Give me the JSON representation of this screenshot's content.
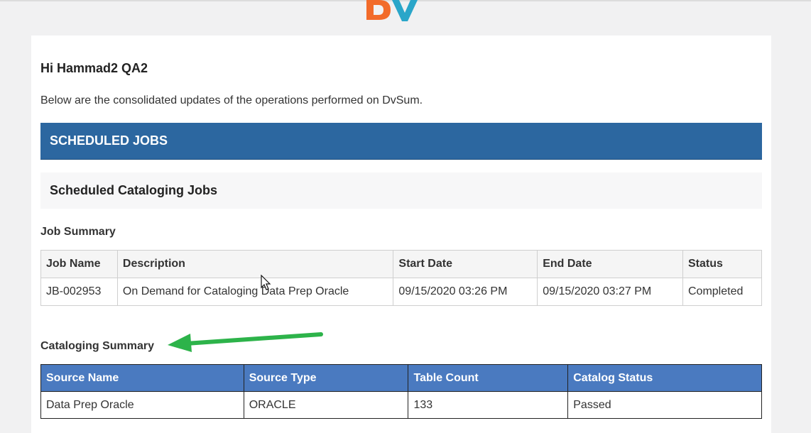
{
  "logo": {
    "text": "DV",
    "colors": {
      "d": "#f26b2a",
      "v": "#2aa6c9"
    }
  },
  "email": {
    "greeting": "Hi Hammad2 QA2",
    "intro": "Below are the consolidated updates of the operations performed on DvSum.",
    "banner": "SCHEDULED JOBS",
    "subheading": "Scheduled Cataloging Jobs"
  },
  "job_summary": {
    "label": "Job Summary",
    "headers": [
      "Job Name",
      "Description",
      "Start Date",
      "End Date",
      "Status"
    ],
    "rows": [
      [
        "JB-002953",
        "On Demand for Cataloging Data Prep Oracle",
        "09/15/2020 03:26 PM",
        "09/15/2020 03:27 PM",
        "Completed"
      ]
    ]
  },
  "cataloging_summary": {
    "label": "Cataloging Summary",
    "headers": [
      "Source Name",
      "Source Type",
      "Table Count",
      "Catalog Status"
    ],
    "rows": [
      [
        "Data Prep Oracle",
        "ORACLE",
        "133",
        "Passed"
      ]
    ]
  },
  "annotation": {
    "icon": "green-arrow-icon",
    "color": "#2db34a"
  },
  "colors": {
    "banner": "#2c67a0",
    "table_header": "#4a7ac0"
  }
}
